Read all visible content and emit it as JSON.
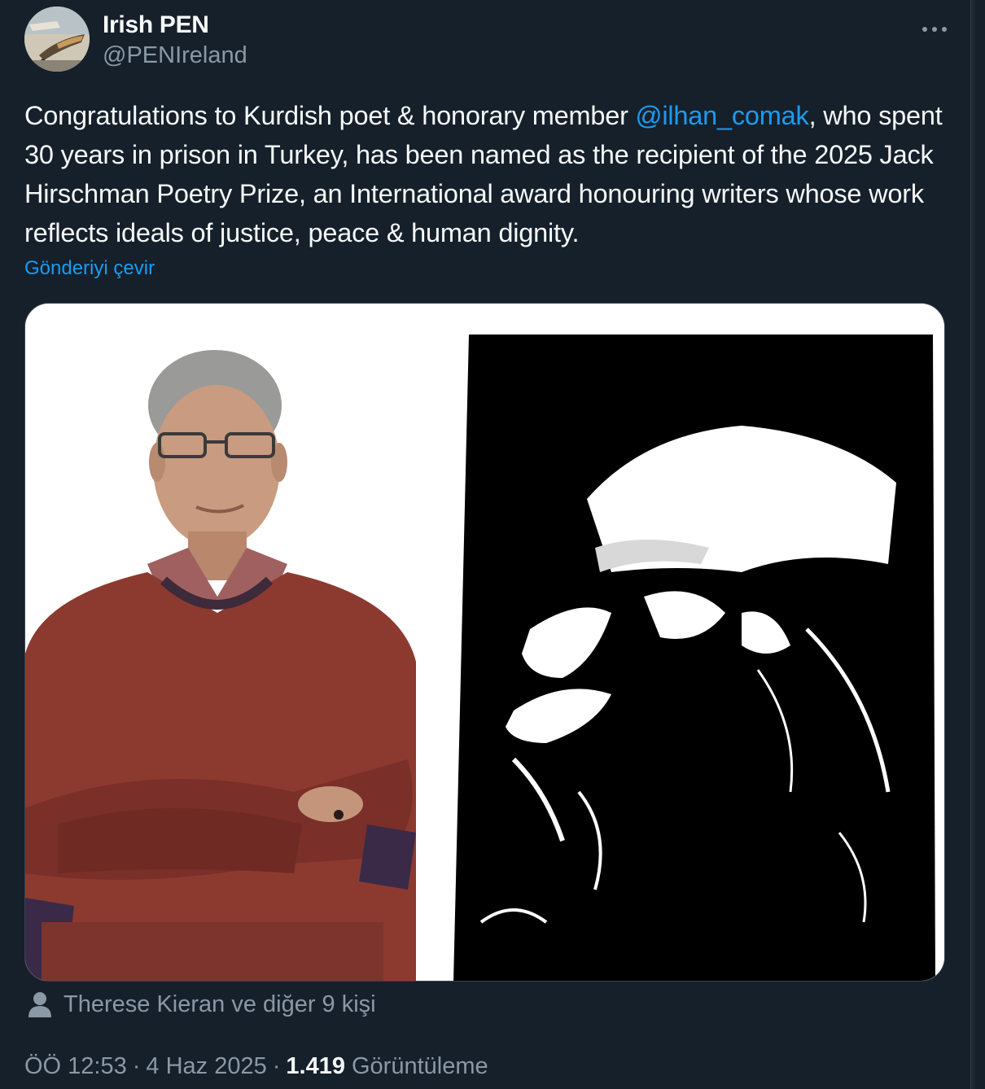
{
  "author": {
    "display_name": "Irish PEN",
    "handle": "@PENIreland",
    "avatar_icon": "pen-nib-avatar"
  },
  "more_icon": "more-horizontal-icon",
  "tweet": {
    "text_before_mention": "Congratulations to Kurdish poet & honorary member ",
    "mention": "@ilhan_comak",
    "text_after_mention": ", who spent 30 years in prison in Turkey, has been named as the recipient of the 2025 Jack Hirschman Poetry Prize, an International award honouring writers whose work reflects ideals of justice, peace & human dignity.",
    "translate_label": "Gönderiyi çevir"
  },
  "media": {
    "left_image": "photo-man-in-red-sweater",
    "right_image": "black-white-portrait-illustration"
  },
  "likers": {
    "icon": "person-icon",
    "text": "Therese Kieran ve diğer 9 kişi"
  },
  "meta": {
    "time": "ÖÖ 12:53",
    "separator": "·",
    "date": "4 Haz 2025",
    "views_count": "1.419",
    "views_label": "Görüntüleme"
  },
  "colors": {
    "background": "#15202b",
    "text": "#f7f9f9",
    "secondary": "#8b98a5",
    "accent": "#1d9bf0",
    "border": "#38444d"
  }
}
